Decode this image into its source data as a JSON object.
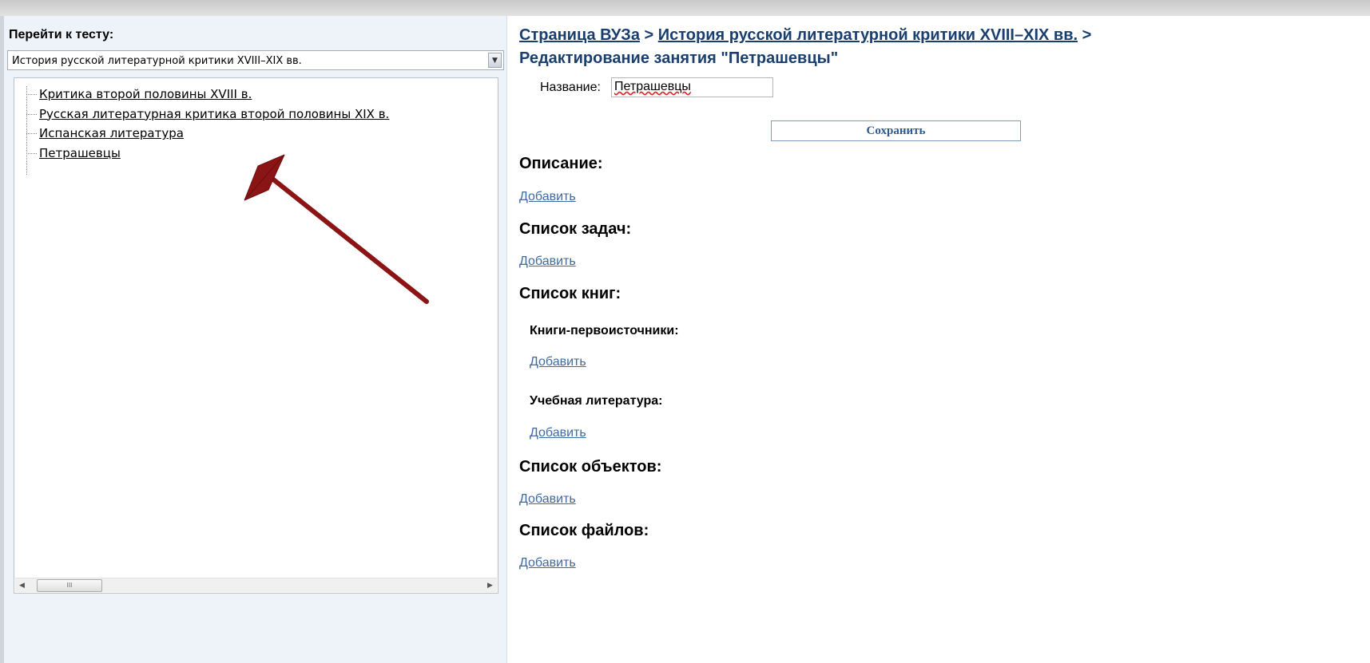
{
  "sidebar": {
    "goto_label": "Перейти к тесту:",
    "selected_course": "История русской литературной критики XVIII–XIX вв.",
    "tree_items": [
      "Критика второй половины XVIII в.",
      "Русская литературная критика второй половины XIX в.",
      "Испанская литература",
      "Петрашевцы"
    ],
    "dropdown_icon": "chevron-down-icon",
    "scroll_thumb_glyph": "III"
  },
  "header": {
    "crumb_university": "Страница ВУЗа",
    "separator": ">",
    "crumb_course": "История русской литературной критики XVIII–XIX вв.",
    "separator_end": ">",
    "title": "Редактирование занятия \"Петрашевцы\""
  },
  "form": {
    "name_label": "Название:",
    "name_value": "Петрашевцы",
    "save_label": "Сохранить"
  },
  "sections": {
    "description": {
      "title": "Описание:",
      "add": "Добавить"
    },
    "tasks": {
      "title": "Список задач:",
      "add": "Добавить"
    },
    "books": {
      "title": "Список книг:",
      "primary": {
        "title": "Книги-первоисточники:",
        "add": "Добавить"
      },
      "educational": {
        "title": "Учебная литература:",
        "add": "Добавить"
      }
    },
    "objects": {
      "title": "Список объектов:",
      "add": "Добавить"
    },
    "files": {
      "title": "Список файлов:",
      "add": "Добавить"
    }
  },
  "colors": {
    "link": "#3c6aa1",
    "heading_link": "#1a3f6f",
    "sidebar_bg": "#eef3fa",
    "annotation_arrow": "#8b1414"
  }
}
